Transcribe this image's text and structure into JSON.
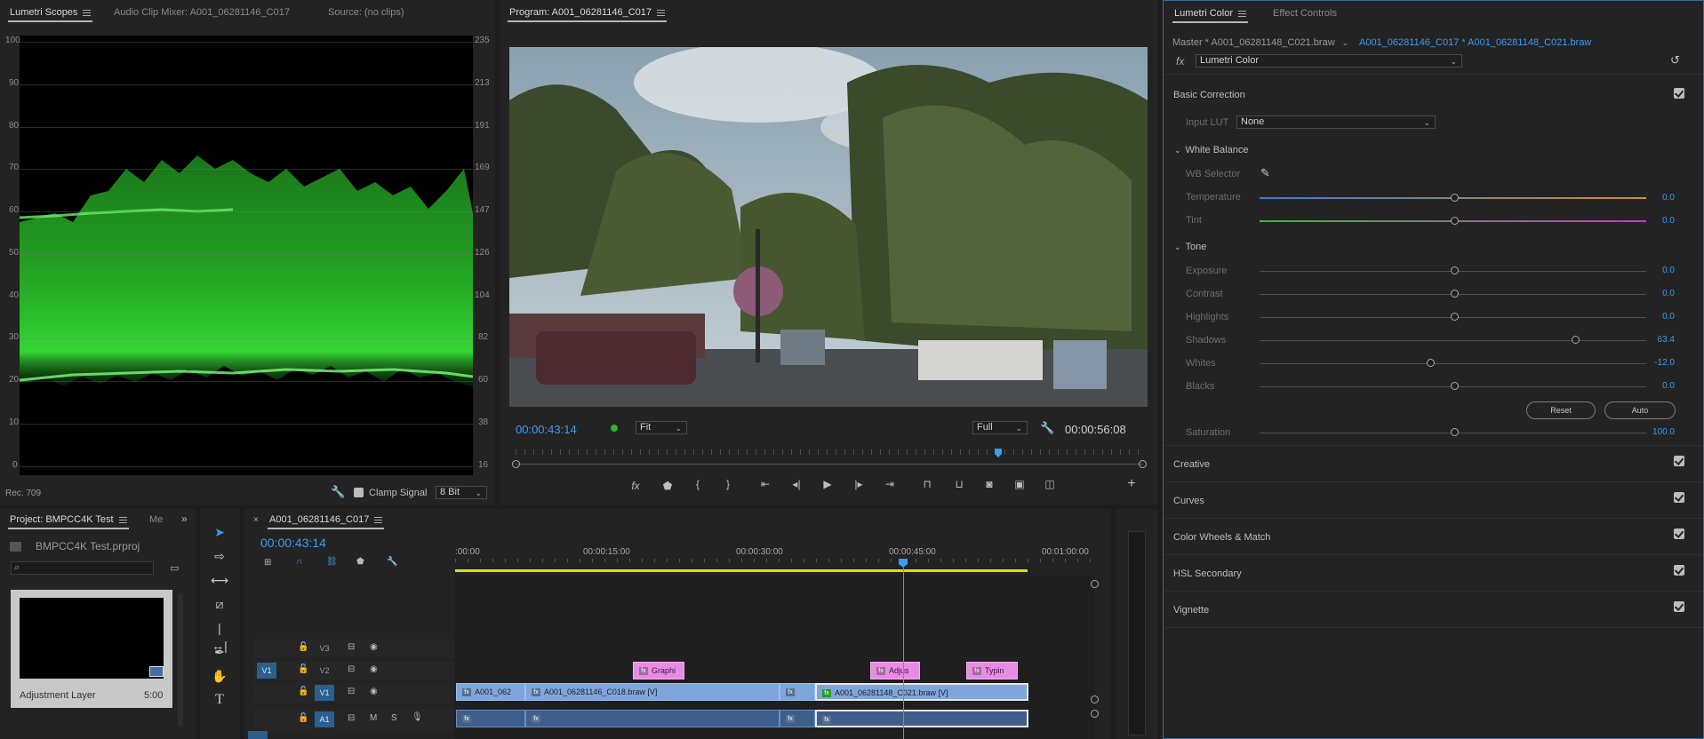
{
  "scopes_panel": {
    "tabs": [
      "Lumetri Scopes",
      "Audio Clip Mixer: A001_06281146_C017",
      "Source: (no clips)"
    ],
    "left_ticks": [
      "100",
      "90",
      "80",
      "70",
      "60",
      "50",
      "40",
      "30",
      "20",
      "10",
      "0"
    ],
    "right_ticks": [
      "235",
      "213",
      "191",
      "169",
      "147",
      "126",
      "104",
      "82",
      "60",
      "38",
      "16"
    ],
    "color_space": "Rec. 709",
    "clamp_label": "Clamp Signal",
    "bit_depth": "8 Bit",
    "waveform_color": "#2fd42f"
  },
  "program_monitor": {
    "title": "Program: A001_06281146_C017",
    "current_time": "00:00:43:14",
    "fit": "Fit",
    "quality": "Full",
    "duration": "00:00:56:08",
    "playhead_fraction": 0.766
  },
  "lumetri": {
    "tabs": [
      "Lumetri Color",
      "Effect Controls"
    ],
    "master": "Master * A001_06281148_C021.braw",
    "clip": "A001_06281146_C017 * A001_06281148_C021.braw",
    "effect": "Lumetri Color",
    "basic_correction": "Basic Correction",
    "input_lut_label": "Input LUT",
    "input_lut_value": "None",
    "white_balance": "White Balance",
    "wb_selector": "WB Selector",
    "temperature": {
      "label": "Temperature",
      "value": "0.0"
    },
    "tint": {
      "label": "Tint",
      "value": "0.0"
    },
    "tone": "Tone",
    "exposure": {
      "label": "Exposure",
      "value": "0.0"
    },
    "contrast": {
      "label": "Contrast",
      "value": "0.0"
    },
    "highlights": {
      "label": "Highlights",
      "value": "0.0"
    },
    "shadows": {
      "label": "Shadows",
      "value": "63.4"
    },
    "whites": {
      "label": "Whites",
      "value": "-12.0"
    },
    "blacks": {
      "label": "Blacks",
      "value": "0.0"
    },
    "reset": "Reset",
    "auto": "Auto",
    "saturation": {
      "label": "Saturation",
      "value": "100.0"
    },
    "sections": [
      "Creative",
      "Curves",
      "Color Wheels & Match",
      "HSL Secondary",
      "Vignette"
    ]
  },
  "project": {
    "tab": "Project: BMPCC4K Test",
    "tab2": "Me",
    "file": "BMPCC4K Test.prproj",
    "search_placeholder": "",
    "item_name": "Adjustment Layer",
    "item_duration": "5:00"
  },
  "timeline": {
    "sequence": "A001_06281146_C017",
    "timecode": "00:00:43:14",
    "ruler": [
      ":00:00",
      "00:00:15:00",
      "00:00:30:00",
      "00:00:45:00",
      "00:01:00:00"
    ],
    "tracks": {
      "v3": "V3",
      "v2": "V2",
      "v1": "V1",
      "a1": "A1",
      "src_v1": "V1",
      "m": "M",
      "s": "S"
    },
    "clips": {
      "g": "Graphi",
      "adj": "Adjus",
      "typ": "Typin",
      "c1": "A001_062",
      "c2": "A001_06281146_C018.braw [V]",
      "c3": "A001_06281148_C021.braw [V]"
    }
  },
  "colors": {
    "accent": "#3d9bf0",
    "video_clip": "#7ea6dc",
    "graphic_clip": "#e88be3",
    "audio_clip": "#3f5f8a",
    "work_area": "#e0e000"
  }
}
